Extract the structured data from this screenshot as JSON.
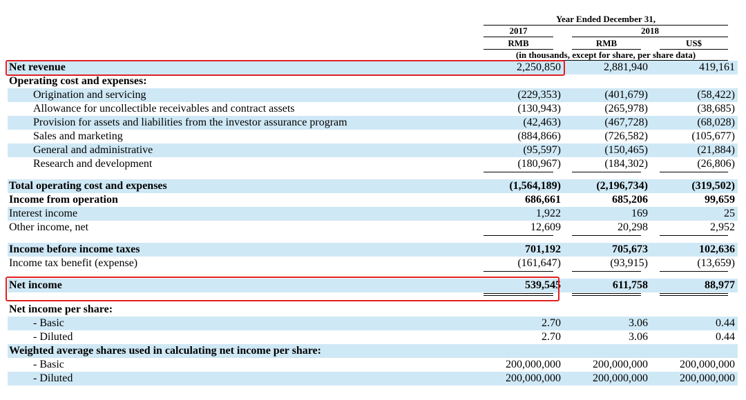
{
  "header": {
    "period": "Year Ended December 31,",
    "year_2017": "2017",
    "year_2018": "2018",
    "currency_c1": "RMB",
    "currency_c2": "RMB",
    "currency_c3": "US$",
    "note": "(in thousands, except for share, per share data)"
  },
  "rows": {
    "net_revenue": {
      "label": "Net revenue",
      "c1": "2,250,850",
      "c2": "2,881,940",
      "c3": "419,161"
    },
    "opex_header": {
      "label": "Operating cost and expenses:"
    },
    "origination": {
      "label": "Origination and servicing",
      "c1": "(229,353)",
      "c2": "(401,679)",
      "c3": "(58,422)"
    },
    "allowance": {
      "label": "Allowance for uncollectible receivables and contract assets",
      "c1": "(130,943)",
      "c2": "(265,978)",
      "c3": "(38,685)"
    },
    "provision": {
      "label": "Provision for assets and liabilities from the investor assurance program",
      "c1": "(42,463)",
      "c2": "(467,728)",
      "c3": "(68,028)"
    },
    "sales": {
      "label": "Sales and marketing",
      "c1": "(884,866)",
      "c2": "(726,582)",
      "c3": "(105,677)"
    },
    "general": {
      "label": "General and administrative",
      "c1": "(95,597)",
      "c2": "(150,465)",
      "c3": "(21,884)"
    },
    "research": {
      "label": "Research and development",
      "c1": "(180,967)",
      "c2": "(184,302)",
      "c3": "(26,806)"
    },
    "total_opex": {
      "label": "Total operating cost and expenses",
      "c1": "(1,564,189)",
      "c2": "(2,196,734)",
      "c3": "(319,502)"
    },
    "income_operation": {
      "label": "Income from operation",
      "c1": "686,661",
      "c2": "685,206",
      "c3": "99,659"
    },
    "interest_income": {
      "label": "Interest income",
      "c1": "1,922",
      "c2": "169",
      "c3": "25"
    },
    "other_income": {
      "label": "Other income, net",
      "c1": "12,609",
      "c2": "20,298",
      "c3": "2,952"
    },
    "income_before_tax": {
      "label": "Income before income taxes",
      "c1": "701,192",
      "c2": "705,673",
      "c3": "102,636"
    },
    "income_tax": {
      "label": "Income tax benefit (expense)",
      "c1": "(161,647)",
      "c2": "(93,915)",
      "c3": "(13,659)"
    },
    "net_income": {
      "label": "Net income",
      "c1": "539,545",
      "c2": "611,758",
      "c3": "88,977"
    },
    "nips_header": {
      "label": "Net income per share:"
    },
    "nips_basic": {
      "label": "- Basic",
      "c1": "2.70",
      "c2": "3.06",
      "c3": "0.44"
    },
    "nips_diluted": {
      "label": "- Diluted",
      "c1": "2.70",
      "c2": "3.06",
      "c3": "0.44"
    },
    "was_header": {
      "label": "Weighted average shares used in calculating net income per share:"
    },
    "was_basic": {
      "label": "- Basic",
      "c1": "200,000,000",
      "c2": "200,000,000",
      "c3": "200,000,000"
    },
    "was_diluted": {
      "label": "- Diluted",
      "c1": "200,000,000",
      "c2": "200,000,000",
      "c3": "200,000,000"
    }
  },
  "colors": {
    "row_shade": "#cfe8f5",
    "highlight": "#e02020"
  }
}
